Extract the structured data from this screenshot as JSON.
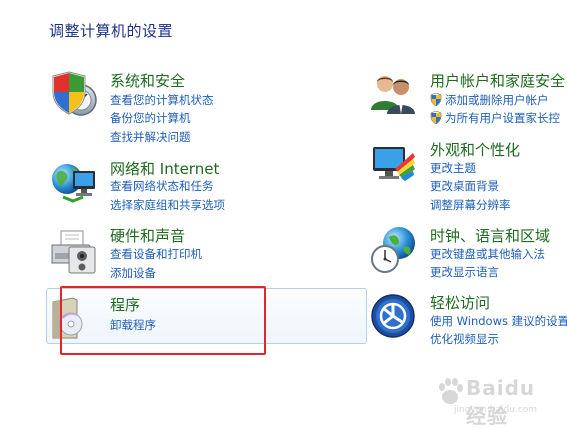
{
  "page_title": "调整计算机的设置",
  "categories": {
    "system_security": {
      "title": "系统和安全",
      "icon": "security-shield-icon",
      "links": [
        "查看您的计算机状态",
        "备份您的计算机",
        "查找并解决问题"
      ]
    },
    "network": {
      "title": "网络和 Internet",
      "icon": "network-globe-icon",
      "links": [
        "查看网络状态和任务",
        "选择家庭组和共享选项"
      ]
    },
    "hardware_sound": {
      "title": "硬件和声音",
      "icon": "printer-icon",
      "links": [
        "查看设备和打印机",
        "添加设备"
      ]
    },
    "programs": {
      "title": "程序",
      "icon": "programs-box-icon",
      "links": [
        "卸载程序"
      ]
    },
    "user_accounts": {
      "title": "用户帐户和家庭安全",
      "icon": "users-icon",
      "links": [
        "添加或删除用户帐户",
        "为所有用户设置家长控"
      ]
    },
    "appearance": {
      "title": "外观和个性化",
      "icon": "monitor-palette-icon",
      "links": [
        "更改主题",
        "更改桌面背景",
        "调整屏幕分辨率"
      ]
    },
    "clock_region": {
      "title": "时钟、语言和区域",
      "icon": "clock-globe-icon",
      "links": [
        "更改键盘或其他输入法",
        "更改显示语言"
      ]
    },
    "ease_of_access": {
      "title": "轻松访问",
      "icon": "ease-of-access-icon",
      "links": [
        "使用 Windows 建议的设置",
        "优化视频显示"
      ]
    }
  },
  "watermark": {
    "brand": "Baidu 经验",
    "url": "jingyan.baidu.com"
  },
  "colors": {
    "heading": "#1e6b1e",
    "link": "#1f5fb8",
    "title": "#1e3287",
    "annotation": "#e0262a"
  }
}
